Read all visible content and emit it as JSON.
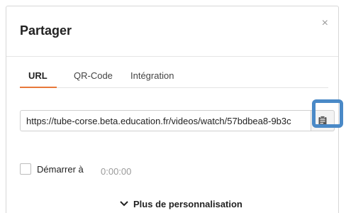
{
  "dialog": {
    "title": "Partager",
    "close_icon": "×"
  },
  "tabs": [
    {
      "label": "URL",
      "active": true
    },
    {
      "label": "QR-Code",
      "active": false
    },
    {
      "label": "Intégration",
      "active": false
    }
  ],
  "url_field": {
    "value": "https://tube-corse.beta.education.fr/videos/watch/57bdbea8-9b3c"
  },
  "copy_button": {
    "icon": "clipboard-icon"
  },
  "start_option": {
    "label": "Démarrer à",
    "time_value": "0:00:00",
    "checked": false
  },
  "more_options": {
    "label": "Plus de personnalisation",
    "icon": "chevron-down-icon"
  },
  "colors": {
    "accent": "#e8783a",
    "highlight": "#4a89c7"
  }
}
